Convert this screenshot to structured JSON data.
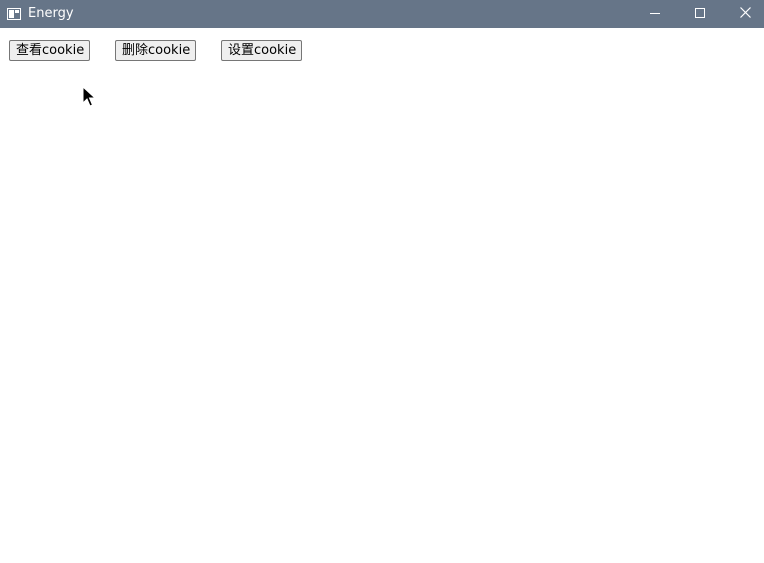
{
  "window": {
    "title": "Energy",
    "titlebar_color": "#667588"
  },
  "toolbar": {
    "view_cookie_label": "查看cookie",
    "delete_cookie_label": "删除cookie",
    "set_cookie_label": "设置cookie"
  },
  "icons": {
    "app": "app-window-icon",
    "minimize": "minimize-icon",
    "maximize": "maximize-icon",
    "close": "close-icon",
    "cursor": "mouse-cursor-icon"
  }
}
